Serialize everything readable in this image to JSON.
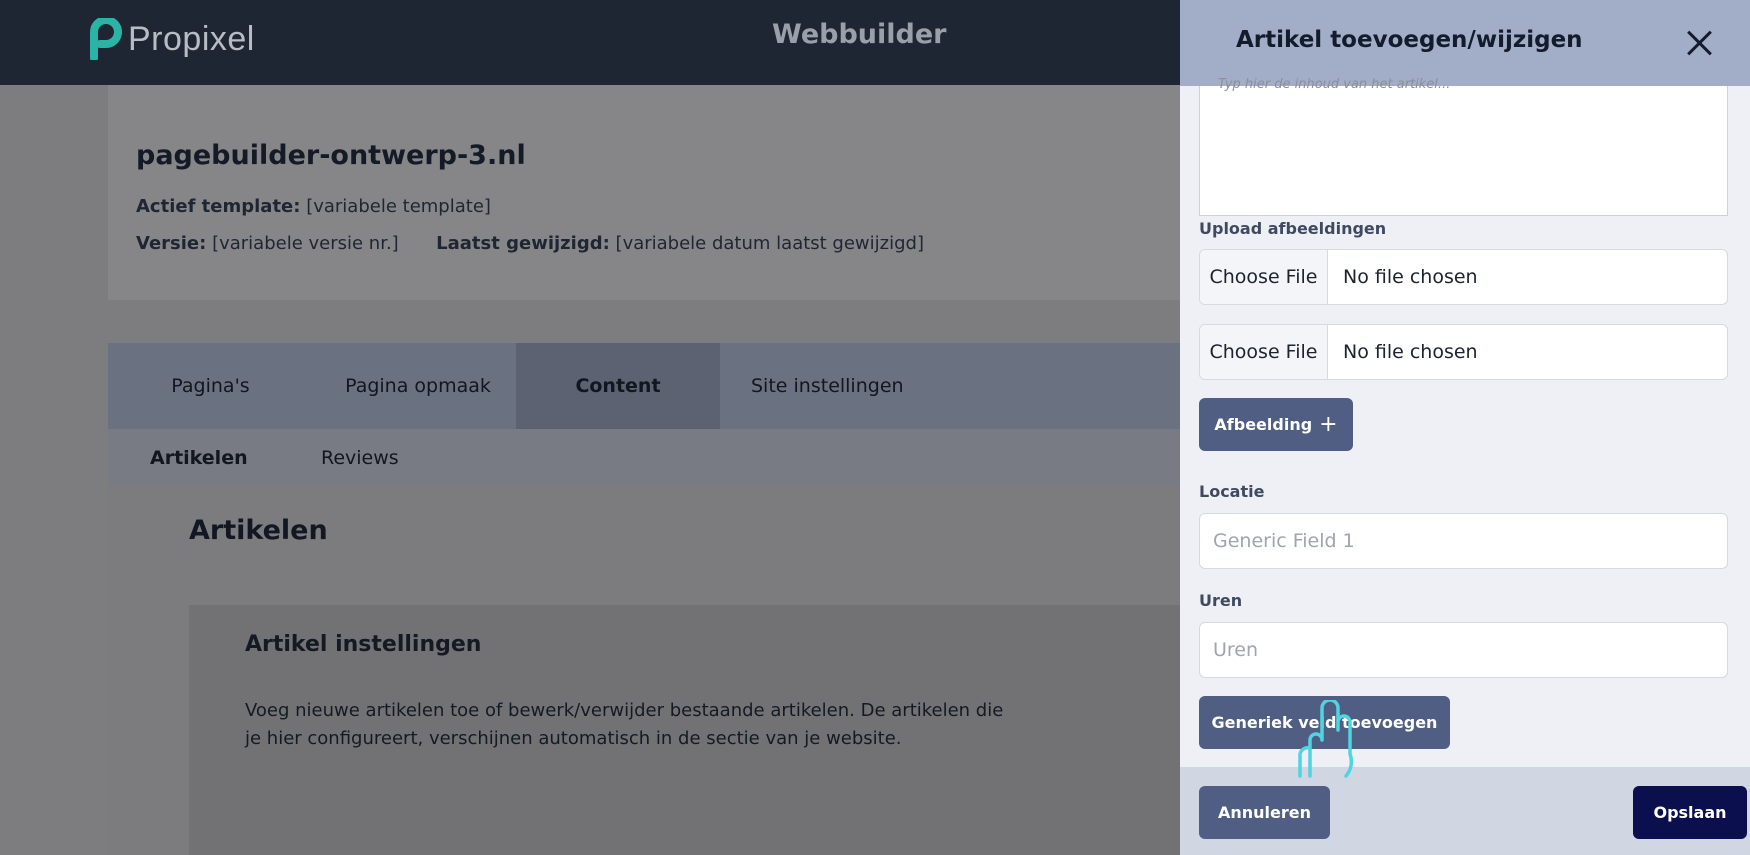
{
  "app": {
    "brand": "Propixel",
    "title": "Webbuilder"
  },
  "site": {
    "name": "pagebuilder-ontwerp-3.nl",
    "template_label": "Actief template:",
    "template_value": "[variabele template]",
    "version_label": "Versie:",
    "version_value": "[variabele versie nr.]",
    "modified_label": "Laatst gewijzigd:",
    "modified_value": "[variabele datum laatst gewijzigd]"
  },
  "tabs": [
    {
      "label": "Pagina's"
    },
    {
      "label": "Pagina opmaak"
    },
    {
      "label": "Content"
    },
    {
      "label": "Site instellingen"
    }
  ],
  "active_tab": "Content",
  "subtabs": [
    {
      "label": "Artikelen"
    },
    {
      "label": "Reviews"
    }
  ],
  "active_subtab": "Artikelen",
  "main": {
    "section_title": "Artikelen",
    "settings_title": "Artikel instellingen",
    "settings_description": "Voeg nieuwe artikelen toe of bewerk/verwijder bestaande artikelen. De artikelen die je hier configureert, verschijnen automatisch in de sectie van je website."
  },
  "panel": {
    "title": "Artikel toevoegen/wijzigen",
    "content_placeholder": "Typ hier de inhoud van het artikel...",
    "upload_label": "Upload afbeeldingen",
    "file_button_label": "Choose File",
    "file_status": "No file chosen",
    "add_image_label": "Afbeelding",
    "location_label": "Locatie",
    "location_placeholder": "Generic Field 1",
    "hours_label": "Uren",
    "hours_placeholder": "Uren",
    "add_generic_field_label": "Generiek veld toevoegen",
    "cancel_label": "Annuleren",
    "save_label": "Opslaan"
  },
  "icons": {
    "close": "close-icon",
    "plus": "plus-icon",
    "pointer": "hand-pointer-icon",
    "logo": "propixel-logo-icon"
  },
  "colors": {
    "topbar": "#1f2633",
    "brand_teal": "#2bb3a6",
    "button": "#4f5e82",
    "save_button": "#0b0f4e",
    "panel_header": "#a2aec7",
    "pointer": "#4fd4e0"
  }
}
